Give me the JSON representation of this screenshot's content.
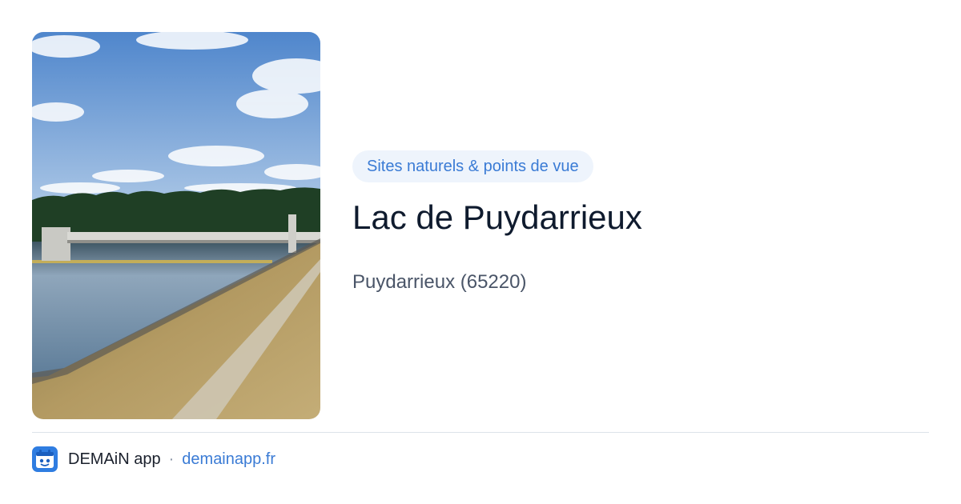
{
  "photo": {
    "icon": "lake-dam-photo",
    "colors": {
      "sky_top": "#5b8fd0",
      "sky_bottom": "#a9c6e6",
      "trees": "#1f3f25",
      "water": "#6d8aa3",
      "grass": "#b39a62",
      "path": "#cfc8b6"
    }
  },
  "category": {
    "label": "Sites naturels & points de vue"
  },
  "place": {
    "title": "Lac de Puydarrieux",
    "location": "Puydarrieux (65220)"
  },
  "footer": {
    "app_icon": "demain-app-icon",
    "app_name": "DEMAiN app",
    "separator": "·",
    "domain": "demainapp.fr"
  },
  "colors": {
    "accent": "#3a7bd5",
    "pill_background": "#eef4fc",
    "title": "#0f1b2e",
    "muted": "#4a5568",
    "divider": "#dde3ea"
  }
}
